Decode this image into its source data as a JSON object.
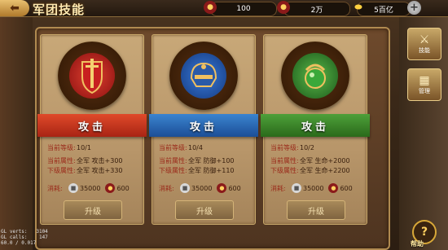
{
  "header": {
    "back_icon": "arrow-left-icon",
    "title": "军团技能"
  },
  "resources": [
    {
      "icon": "coin-bag-icon",
      "value": "100"
    },
    {
      "icon": "money-bag-icon",
      "value": "2万"
    },
    {
      "icon": "gold-ingot-icon",
      "value": "5百亿"
    }
  ],
  "cards": [
    {
      "emblem": "red-sword-shield-emblem",
      "name": "攻击",
      "ribbon_color": "#c83a22",
      "level_label": "当前等级:",
      "level": "10/1",
      "cur_label": "当前属性:",
      "cur_value": "全军 攻击+300",
      "next_label": "下级属性:",
      "next_value": "全军 攻击+330",
      "cost_label": "消耗:",
      "cost_silver": "35000",
      "cost_food": "600",
      "upgrade_label": "升级"
    },
    {
      "emblem": "blue-helmet-emblem",
      "name": "攻击",
      "ribbon_color": "#2a6ab8",
      "level_label": "当前等级:",
      "level": "10/4",
      "cur_label": "当前属性:",
      "cur_value": "全军 防御+100",
      "next_label": "下级属性:",
      "next_value": "全军 防御+110",
      "cost_label": "消耗:",
      "cost_silver": "35000",
      "cost_food": "600",
      "upgrade_label": "升级"
    },
    {
      "emblem": "green-jade-emblem",
      "name": "攻击",
      "ribbon_color": "#3a8a2a",
      "level_label": "当前等级:",
      "level": "10/2",
      "cur_label": "当前属性:",
      "cur_value": "全军 生命+2000",
      "next_label": "下级属性:",
      "next_value": "全军 生命+2200",
      "cost_label": "消耗:",
      "cost_silver": "35000",
      "cost_food": "600",
      "upgrade_label": "升级"
    }
  ],
  "side_menu": [
    {
      "icon": "crossed-swords-icon",
      "label": "技能"
    },
    {
      "icon": "grid-manage-icon",
      "label": "管理"
    }
  ],
  "helper": {
    "label": "帮助"
  },
  "debug": {
    "line1": "GL verts:   3104",
    "line2": "GL calls:    147",
    "line3": "60.0 / 0.017"
  }
}
